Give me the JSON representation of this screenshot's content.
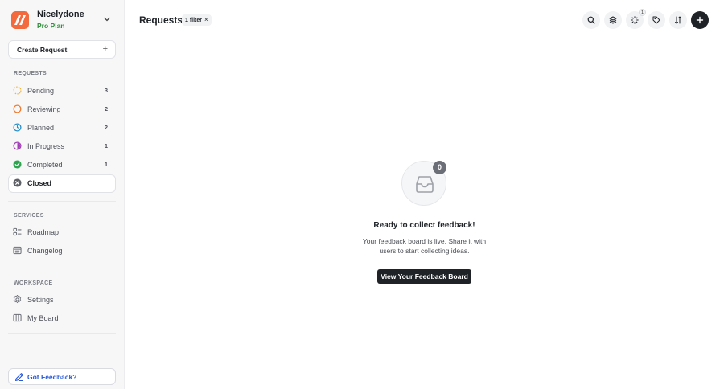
{
  "brand": {
    "name": "Nicelydone",
    "plan": "Pro Plan"
  },
  "sidebar": {
    "create_label": "Create Request",
    "create_icon": "plus-icon",
    "requests_label": "REQUESTS",
    "requests": [
      {
        "label": "Pending",
        "count": "3",
        "icon": "pending-dashed-circle-icon",
        "color": "#f2b531"
      },
      {
        "label": "Reviewing",
        "count": "2",
        "icon": "reviewing-circle-icon",
        "color": "#f07a2c"
      },
      {
        "label": "Planned",
        "count": "2",
        "icon": "planned-clock-icon",
        "color": "#2a8fc7"
      },
      {
        "label": "In Progress",
        "count": "1",
        "icon": "in-progress-half-circle-icon",
        "color": "#a23fb7"
      },
      {
        "label": "Completed",
        "count": "1",
        "icon": "completed-check-icon",
        "color": "#2ea44f"
      },
      {
        "label": "Closed",
        "count": "",
        "icon": "closed-x-icon",
        "color": "#5f6168"
      }
    ],
    "services_label": "SERVICES",
    "services": [
      {
        "label": "Roadmap",
        "icon": "roadmap-icon"
      },
      {
        "label": "Changelog",
        "icon": "changelog-icon"
      }
    ],
    "workspace_label": "WORKSPACE",
    "workspace": [
      {
        "label": "Settings",
        "icon": "gear-icon"
      },
      {
        "label": "My Board",
        "icon": "board-icon"
      }
    ],
    "feedback_label": "Got Feedback?"
  },
  "header": {
    "title": "Requests",
    "filter_label": "1 filter",
    "filter_clear": "×",
    "notification_count": "1"
  },
  "empty_state": {
    "count": "0",
    "title": "Ready to collect feedback!",
    "description": "Your feedback board is live. Share it with users to start collecting ideas.",
    "cta": "View Your Feedback Board"
  },
  "colors": {
    "accent": "#1f2328",
    "plan": "#2f8f3a",
    "link": "#2a5bd7"
  }
}
